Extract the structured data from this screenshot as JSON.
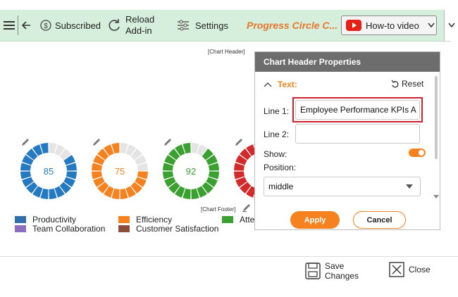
{
  "toolbar": {
    "subscribed_label": "Subscribed",
    "reload_line1": "Reload",
    "reload_line2": "Add-in",
    "settings_label": "Settings",
    "brand_title": "Progress Circle C...",
    "howto_label": "How-to video"
  },
  "chart": {
    "header_chip": "[Chart Header]",
    "footer_chip": "[Chart Footer]",
    "circles": [
      {
        "value": 85,
        "label": "85",
        "color": "#2479c1"
      },
      {
        "value": 75,
        "label": "75",
        "color": "#f5821f"
      },
      {
        "value": 92,
        "label": "92",
        "color": "#3aa030"
      },
      {
        "value": 80,
        "label": "",
        "color": "#d22a2a"
      }
    ],
    "legend": [
      {
        "label": "Productivity",
        "color": "#2f6fae"
      },
      {
        "label": "Team Collaboration",
        "color": "#8e6cc0"
      },
      {
        "label": "Efficiency",
        "color": "#f5821f"
      },
      {
        "label": "Customer Satisfaction",
        "color": "#8b4e3a"
      },
      {
        "label": "Atte",
        "color": "#3aa030"
      }
    ]
  },
  "panel": {
    "title": "Chart Header Properties",
    "section_label": "Text:",
    "reset_label": "Reset",
    "line1_label": "Line 1:",
    "line1_value": "Employee Performance KPIs A",
    "line2_label": "Line 2:",
    "line2_value": "",
    "show_label": "Show:",
    "position_label": "Position:",
    "position_value": "middle",
    "apply_label": "Apply",
    "cancel_label": "Cancel"
  },
  "footer": {
    "save_line1": "Save",
    "save_line2": "Changes",
    "close_label": "Close"
  },
  "colors": {
    "toolbar_bg": "#d5efdc",
    "accent_orange": "#f5821f",
    "brand_orange": "#e8772e",
    "highlight_red": "#d0202a",
    "youtube_red": "#e62117"
  }
}
